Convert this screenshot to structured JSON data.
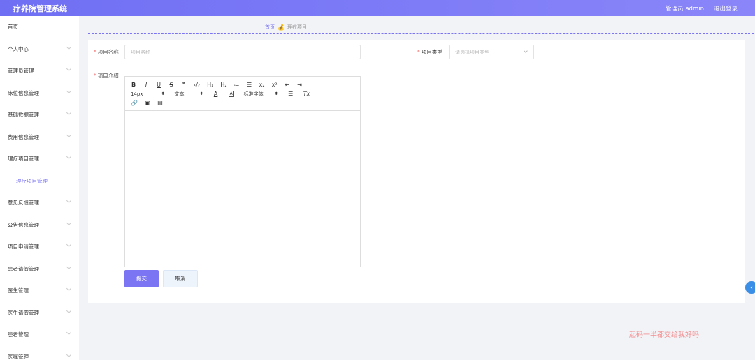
{
  "header": {
    "app_title": "疗养院管理系统",
    "user_label": "管理员 admin",
    "logout_label": "退出登录"
  },
  "sidebar": {
    "items": [
      {
        "label": "首页"
      },
      {
        "label": "个人中心"
      },
      {
        "label": "管理员管理"
      },
      {
        "label": "床位信息管理"
      },
      {
        "label": "基础数据管理"
      },
      {
        "label": "费用信息管理"
      },
      {
        "label": "理疗项目管理"
      },
      {
        "label": "理疗项目管理"
      },
      {
        "label": "意见反馈管理"
      },
      {
        "label": "公告信息管理"
      },
      {
        "label": "项目申请管理"
      },
      {
        "label": "患者请假管理"
      },
      {
        "label": "医生管理"
      },
      {
        "label": "医生请假管理"
      },
      {
        "label": "患者管理"
      },
      {
        "label": "医嘱管理"
      }
    ]
  },
  "breadcrumb": {
    "home": "首页",
    "current": "理疗项目"
  },
  "form": {
    "name_label": "项目名称",
    "name_placeholder": "项目名称",
    "name_value": "",
    "type_label": "项目类型",
    "type_placeholder": "请选择项目类型",
    "intro_label": "项目介绍",
    "required_mark": "*"
  },
  "editor": {
    "row1": [
      "B",
      "I",
      "U",
      "S",
      "❞",
      "‹/›",
      "H₁",
      "H₂",
      "≔",
      "☰",
      "x₂",
      "x²",
      "⇤",
      "⇥"
    ],
    "font_size": "14px",
    "block_type": "文本",
    "font_family": "标准字体",
    "row3": [
      "🔗",
      "▣",
      "▤"
    ]
  },
  "buttons": {
    "submit": "提交",
    "cancel": "取消"
  },
  "watermark": "起码一半都交给我好吗"
}
